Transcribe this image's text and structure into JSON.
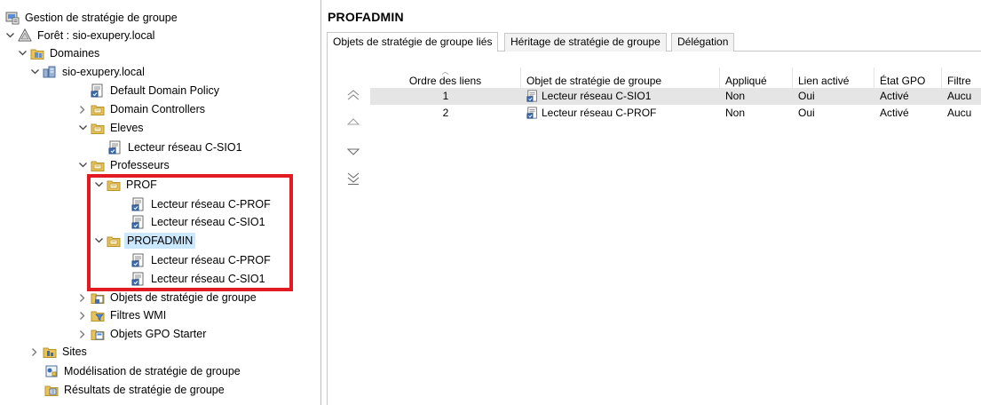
{
  "tree": {
    "root_label": "Gestion de stratégie de groupe",
    "forest_label": "Forêt : sio-exupery.local",
    "domains_label": "Domaines",
    "domain_label": "sio-exupery.local",
    "default_policy": "Default Domain Policy",
    "domain_controllers": "Domain Controllers",
    "eleves": "Eleves",
    "eleves_link": "Lecteur réseau C-SIO1",
    "professeurs": "Professeurs",
    "prof": "PROF",
    "prof_link1": "Lecteur réseau C-PROF",
    "prof_link2": "Lecteur réseau C-SIO1",
    "profadmin": "PROFADMIN",
    "profadmin_link1": "Lecteur réseau C-PROF",
    "profadmin_link2": "Lecteur réseau C-SIO1",
    "gpo_objects": "Objets de stratégie de groupe",
    "wmi_filters": "Filtres WMI",
    "starter_gpos": "Objets GPO Starter",
    "sites": "Sites",
    "modeling": "Modélisation de stratégie de groupe",
    "results": "Résultats de stratégie de groupe"
  },
  "main": {
    "title": "PROFADMIN",
    "tabs": [
      "Objets de stratégie de groupe liés",
      "Héritage de stratégie de groupe",
      "Délégation"
    ],
    "columns": [
      "Ordre des liens",
      "Objet de stratégie de groupe",
      "Appliqué",
      "Lien activé",
      "État GPO",
      "Filtre"
    ],
    "rows": [
      {
        "order": "1",
        "gpo": "Lecteur réseau C-SIO1",
        "enforced": "Non",
        "link_enabled": "Oui",
        "status": "Activé",
        "filter": "Aucu"
      },
      {
        "order": "2",
        "gpo": "Lecteur réseau C-PROF",
        "enforced": "Non",
        "link_enabled": "Oui",
        "status": "Activé",
        "filter": "Aucu"
      }
    ]
  },
  "colors": {
    "highlight": "#e21b23",
    "selection": "#cce8ff",
    "folder": "#e8c35a"
  }
}
